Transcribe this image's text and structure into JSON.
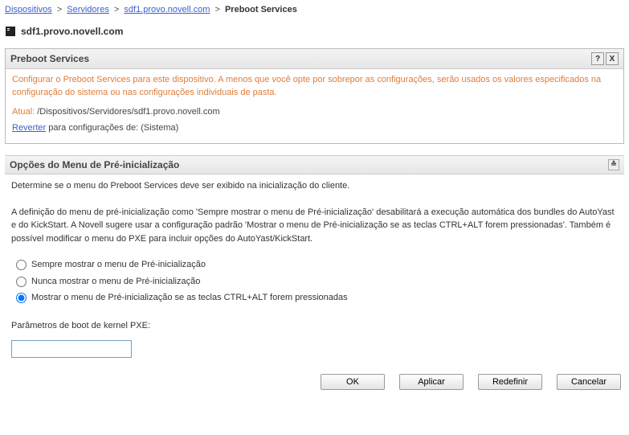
{
  "breadcrumb": {
    "items": [
      {
        "label": "Dispositivos",
        "link": true
      },
      {
        "label": "Servidores",
        "link": true
      },
      {
        "label": "sdf1.provo.novell.com",
        "link": true
      },
      {
        "label": "Preboot Services",
        "link": false
      }
    ]
  },
  "device": {
    "name": "sdf1.provo.novell.com"
  },
  "panel": {
    "title": "Preboot Services",
    "description": "Configurar o Preboot Services para este dispositivo. A menos que você opte por sobrepor as configurações, serão usados os valores especificados na configuração do sistema ou nas configurações individuais de pasta.",
    "atual_label": "Atual:",
    "atual_path": "/Dispositivos/Servidores/sdf1.provo.novell.com",
    "revert_link": "Reverter",
    "revert_rest": " para configurações de: (Sistema)"
  },
  "section": {
    "title": "Opções do Menu de Pré-inicialização",
    "intro": "Determine se o menu do Preboot Services deve ser exibido na inicialização do cliente.",
    "detail": "A definição do menu de pré-inicialização como 'Sempre mostrar o menu de Pré-inicialização' desabilitará a execução automática dos bundles do AutoYast e do KickStart. A Novell sugere usar a configuração padrão 'Mostrar o menu de Pré-inicialização se as teclas CTRL+ALT forem pressionadas'. Também é possível modificar o menu do PXE para incluir opções do AutoYast/KickStart.",
    "options": [
      {
        "label": "Sempre mostrar o menu de Pré-inicialização",
        "selected": false
      },
      {
        "label": "Nunca mostrar o menu de Pré-inicialização",
        "selected": false
      },
      {
        "label": "Mostrar o menu de Pré-inicialização se as teclas CTRL+ALT forem pressionadas",
        "selected": true
      }
    ],
    "param_label": "Parâmetros de boot de kernel PXE:",
    "param_value": ""
  },
  "buttons": {
    "ok": "OK",
    "apply": "Aplicar",
    "reset": "Redefinir",
    "cancel": "Cancelar"
  },
  "icons": {
    "help": "?",
    "close": "X",
    "collapse": "≲"
  }
}
